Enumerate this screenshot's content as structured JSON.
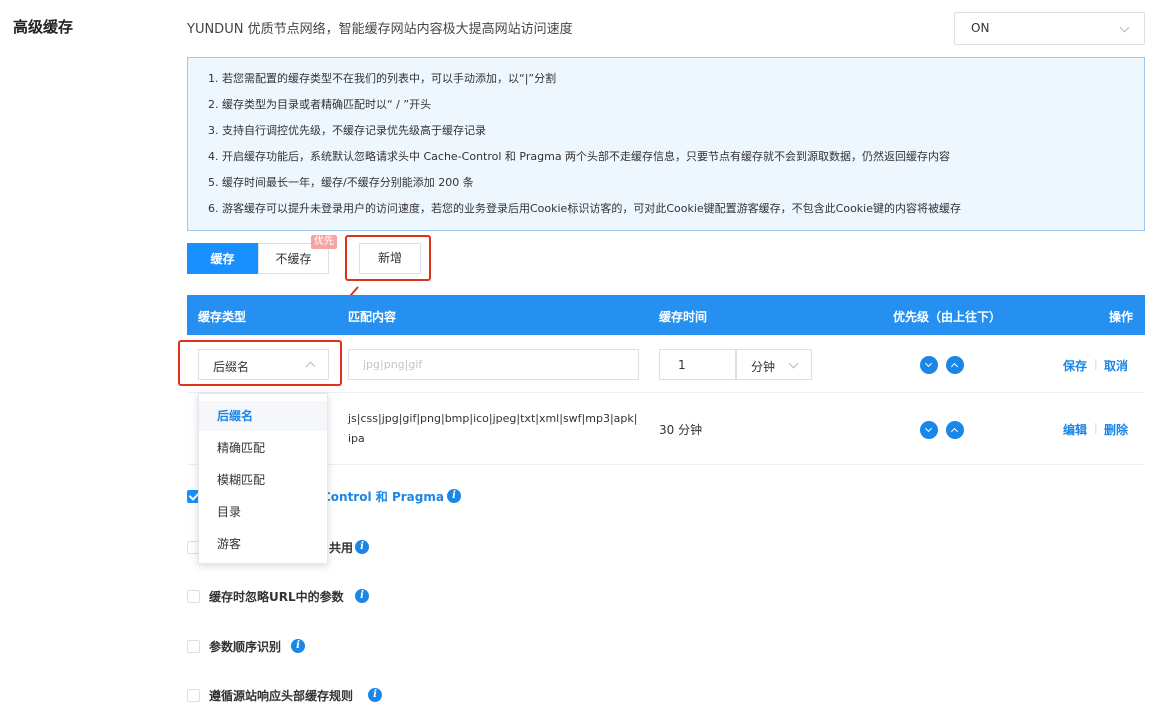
{
  "section": {
    "title": "高级缓存"
  },
  "header": {
    "description": "YUNDUN 优质节点网络，智能缓存网站内容极大提高网站访问速度",
    "toggle_value": "ON"
  },
  "notice": {
    "items": [
      "1. 若您需配置的缓存类型不在我们的列表中，可以手动添加，以“|”分割",
      "2. 缓存类型为目录或者精确匹配时以“ / ”开头",
      "3. 支持自行调控优先级，不缓存记录优先级高于缓存记录",
      "4. 开启缓存功能后，系统默认忽略请求头中 Cache-Control 和 Pragma 两个头部不走缓存信息，只要节点有缓存就不会到源取数据，仍然返回缓存内容",
      "5. 缓存时间最长一年，缓存/不缓存分别能添加 200 条",
      "6. 游客缓存可以提升未登录用户的访问速度，若您的业务登录后用Cookie标识访客的，可对此Cookie键配置游客缓存，不包含此Cookie键的内容将被缓存"
    ]
  },
  "tabs": {
    "cache": "缓存",
    "nocache": "不缓存",
    "badge": "优先"
  },
  "toolbar": {
    "add": "新增"
  },
  "table": {
    "headers": [
      "缓存类型",
      "匹配内容",
      "缓存时间",
      "优先级（由上往下）",
      "操作"
    ],
    "edit_row": {
      "type": "后缀名",
      "match_placeholder": "jpg|png|gif",
      "time_value": "1",
      "unit": "分钟",
      "save": "保存",
      "cancel": "取消",
      "sep": "|"
    },
    "row": {
      "match": "js|css|jpg|gif|png|bmp|ico|jpeg|txt|xml|swf|mp3|apk|ipa",
      "time": "30 分钟",
      "edit": "编辑",
      "delete": "删除",
      "sep": "|"
    }
  },
  "dropdown": {
    "options": [
      "后缀名",
      "精确匹配",
      "模糊匹配",
      "目录",
      "游客"
    ]
  },
  "options": [
    {
      "label": "-Control 和 Pragma",
      "checked": true
    },
    {
      "label": "共用",
      "checked": false
    },
    {
      "label": "缓存时忽略URL中的参数",
      "checked": false
    },
    {
      "label": "参数顺序识别",
      "checked": false
    },
    {
      "label": "遵循源站响应头部缓存规则",
      "checked": false
    }
  ],
  "info_glyph": "i",
  "colors": {
    "primary": "#1890ff",
    "highlight": "#e0321b",
    "notice_bg": "#eef6fe"
  }
}
